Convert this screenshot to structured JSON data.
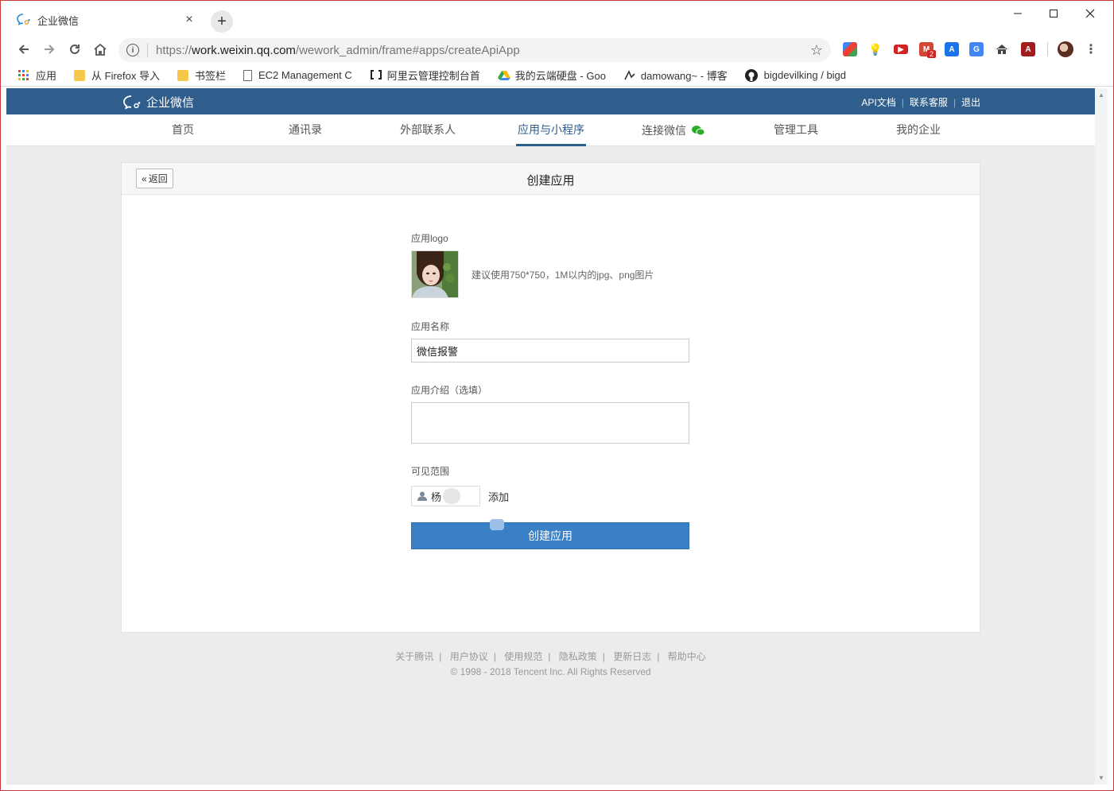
{
  "browser": {
    "tab_title": "企业微信",
    "tab_close": "×",
    "new_tab": "+",
    "url_scheme": "https://",
    "url_host": "work.weixin.qq.com",
    "url_path": "/wework_admin/frame#apps/createApiApp",
    "bookmarks": [
      {
        "label": "应用",
        "icon": "apps-grid-icon"
      },
      {
        "label": "从 Firefox 导入",
        "icon": "folder-icon"
      },
      {
        "label": "书签栏",
        "icon": "folder-icon"
      },
      {
        "label": "EC2 Management C",
        "icon": "page-icon"
      },
      {
        "label": "阿里云管理控制台首",
        "icon": "aliyun-icon"
      },
      {
        "label": "我的云端硬盘 - Goo",
        "icon": "google-drive-icon"
      },
      {
        "label": "damowang~ - 博客",
        "icon": "blog-icon"
      },
      {
        "label": "bigdevilking / bigd",
        "icon": "github-icon"
      }
    ],
    "extensions": [
      "chrome-webstore-icon",
      "lightbulb-icon",
      "youtube-icon",
      "gmail-icon",
      "translate-a-icon",
      "google-translate-icon",
      "home-icon",
      "pdf-icon"
    ],
    "gmail_badge": "2"
  },
  "header": {
    "brand": "企业微信",
    "links": [
      "API文档",
      "联系客服",
      "退出"
    ]
  },
  "nav": {
    "items": [
      "首页",
      "通讯录",
      "外部联系人",
      "应用与小程序",
      "连接微信",
      "管理工具",
      "我的企业"
    ],
    "active": "应用与小程序"
  },
  "card": {
    "back_label": "返回",
    "title": "创建应用"
  },
  "form": {
    "logo_label": "应用logo",
    "logo_hint": "建议使用750*750，1M以内的jpg、png图片",
    "name_label": "应用名称",
    "name_value": "微信报警",
    "intro_label": "应用介绍（选填）",
    "intro_value": "",
    "scope_label": "可见范围",
    "member_name": "杨",
    "add_label": "添加",
    "submit_label": "创建应用"
  },
  "footer": {
    "links": [
      "关于腾讯",
      "用户协议",
      "使用规范",
      "隐私政策",
      "更新日志",
      "帮助中心"
    ],
    "copyright": "© 1998 - 2018 Tencent Inc. All Rights Reserved"
  },
  "colors": {
    "header_bg": "#2f5d8c",
    "button_primary": "#3a80c6",
    "page_bg": "#ececec"
  }
}
